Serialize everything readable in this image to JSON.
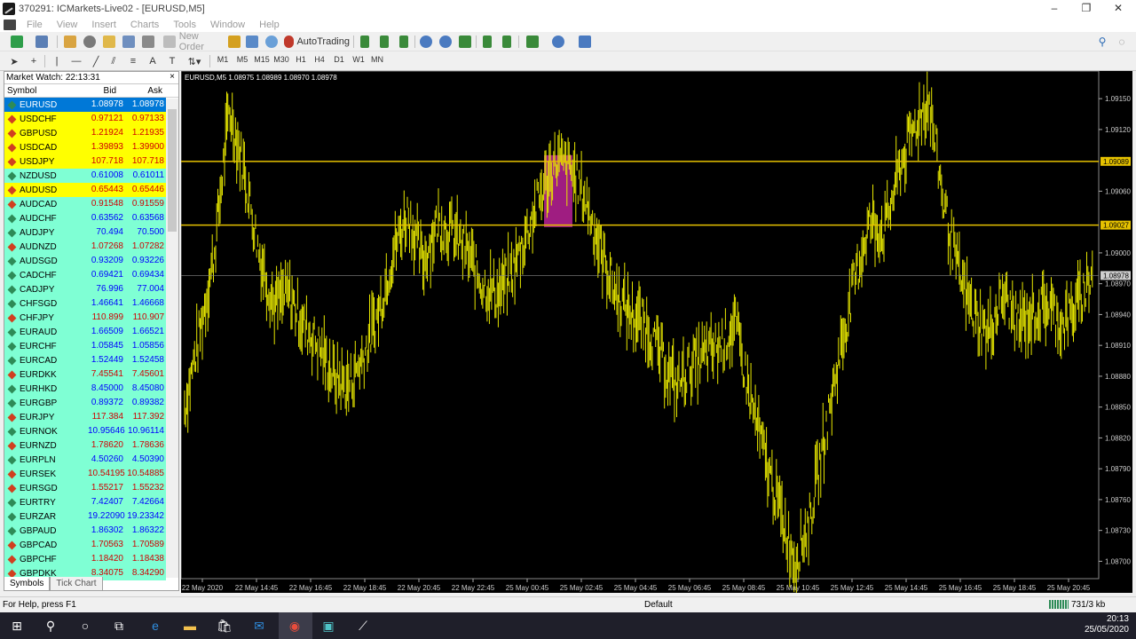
{
  "window": {
    "title": "370291: ICMarkets-Live02 - [EURUSD,M5]",
    "minimize": "–",
    "restore": "❐",
    "close": "✕"
  },
  "menu": [
    "File",
    "View",
    "Insert",
    "Charts",
    "Tools",
    "Window",
    "Help"
  ],
  "toolbar": {
    "new_order": "New Order",
    "autotrading": "AutoTrading",
    "timeframes": [
      "M1",
      "M5",
      "M15",
      "M30",
      "H1",
      "H4",
      "D1",
      "W1",
      "MN"
    ]
  },
  "market_watch": {
    "title": "Market Watch: 22:13:31",
    "close": "×",
    "col_symbol": "Symbol",
    "col_bid": "Bid",
    "col_ask": "Ask",
    "rows": [
      {
        "symbol": "EURUSD",
        "bid": "1.08978",
        "ask": "1.08978",
        "color": "#0078d7",
        "dir": "up"
      },
      {
        "symbol": "USDCHF",
        "bid": "0.97121",
        "ask": "0.97133",
        "color": "#ffff00",
        "dir": "down"
      },
      {
        "symbol": "GBPUSD",
        "bid": "1.21924",
        "ask": "1.21935",
        "color": "#ffff00",
        "dir": "down"
      },
      {
        "symbol": "USDCAD",
        "bid": "1.39893",
        "ask": "1.39900",
        "color": "#ffff00",
        "dir": "down"
      },
      {
        "symbol": "USDJPY",
        "bid": "107.718",
        "ask": "107.718",
        "color": "#ffff00",
        "dir": "down"
      },
      {
        "symbol": "NZDUSD",
        "bid": "0.61008",
        "ask": "0.61011",
        "color": "#7fffd4",
        "dir": "up"
      },
      {
        "symbol": "AUDUSD",
        "bid": "0.65443",
        "ask": "0.65446",
        "color": "#ffff00",
        "dir": "down"
      },
      {
        "symbol": "AUDCAD",
        "bid": "0.91548",
        "ask": "0.91559",
        "color": "#7fffd4",
        "dir": "down"
      },
      {
        "symbol": "AUDCHF",
        "bid": "0.63562",
        "ask": "0.63568",
        "color": "#7fffd4",
        "dir": "up"
      },
      {
        "symbol": "AUDJPY",
        "bid": "70.494",
        "ask": "70.500",
        "color": "#7fffd4",
        "dir": "up"
      },
      {
        "symbol": "AUDNZD",
        "bid": "1.07268",
        "ask": "1.07282",
        "color": "#7fffd4",
        "dir": "down"
      },
      {
        "symbol": "AUDSGD",
        "bid": "0.93209",
        "ask": "0.93226",
        "color": "#7fffd4",
        "dir": "up"
      },
      {
        "symbol": "CADCHF",
        "bid": "0.69421",
        "ask": "0.69434",
        "color": "#7fffd4",
        "dir": "up"
      },
      {
        "symbol": "CADJPY",
        "bid": "76.996",
        "ask": "77.004",
        "color": "#7fffd4",
        "dir": "up"
      },
      {
        "symbol": "CHFSGD",
        "bid": "1.46641",
        "ask": "1.46668",
        "color": "#7fffd4",
        "dir": "up"
      },
      {
        "symbol": "CHFJPY",
        "bid": "110.899",
        "ask": "110.907",
        "color": "#7fffd4",
        "dir": "down"
      },
      {
        "symbol": "EURAUD",
        "bid": "1.66509",
        "ask": "1.66521",
        "color": "#7fffd4",
        "dir": "up"
      },
      {
        "symbol": "EURCHF",
        "bid": "1.05845",
        "ask": "1.05856",
        "color": "#7fffd4",
        "dir": "up"
      },
      {
        "symbol": "EURCAD",
        "bid": "1.52449",
        "ask": "1.52458",
        "color": "#7fffd4",
        "dir": "up"
      },
      {
        "symbol": "EURDKK",
        "bid": "7.45541",
        "ask": "7.45601",
        "color": "#7fffd4",
        "dir": "down"
      },
      {
        "symbol": "EURHKD",
        "bid": "8.45000",
        "ask": "8.45080",
        "color": "#7fffd4",
        "dir": "up"
      },
      {
        "symbol": "EURGBP",
        "bid": "0.89372",
        "ask": "0.89382",
        "color": "#7fffd4",
        "dir": "up"
      },
      {
        "symbol": "EURJPY",
        "bid": "117.384",
        "ask": "117.392",
        "color": "#7fffd4",
        "dir": "down"
      },
      {
        "symbol": "EURNOK",
        "bid": "10.95646",
        "ask": "10.96114",
        "color": "#7fffd4",
        "dir": "up"
      },
      {
        "symbol": "EURNZD",
        "bid": "1.78620",
        "ask": "1.78636",
        "color": "#7fffd4",
        "dir": "down"
      },
      {
        "symbol": "EURPLN",
        "bid": "4.50260",
        "ask": "4.50390",
        "color": "#7fffd4",
        "dir": "up"
      },
      {
        "symbol": "EURSEK",
        "bid": "10.54195",
        "ask": "10.54885",
        "color": "#7fffd4",
        "dir": "down"
      },
      {
        "symbol": "EURSGD",
        "bid": "1.55217",
        "ask": "1.55232",
        "color": "#7fffd4",
        "dir": "down"
      },
      {
        "symbol": "EURTRY",
        "bid": "7.42407",
        "ask": "7.42664",
        "color": "#7fffd4",
        "dir": "up"
      },
      {
        "symbol": "EURZAR",
        "bid": "19.22090",
        "ask": "19.23342",
        "color": "#7fffd4",
        "dir": "up"
      },
      {
        "symbol": "GBPAUD",
        "bid": "1.86302",
        "ask": "1.86322",
        "color": "#7fffd4",
        "dir": "up"
      },
      {
        "symbol": "GBPCAD",
        "bid": "1.70563",
        "ask": "1.70589",
        "color": "#7fffd4",
        "dir": "down"
      },
      {
        "symbol": "GBPCHF",
        "bid": "1.18420",
        "ask": "1.18438",
        "color": "#7fffd4",
        "dir": "down"
      },
      {
        "symbol": "GBPDKK",
        "bid": "8.34075",
        "ask": "8.34290",
        "color": "#7fffd4",
        "dir": "down"
      }
    ],
    "tabs": [
      "Symbols",
      "Tick Chart"
    ]
  },
  "chart": {
    "info": "EURUSD,M5  1.08975 1.08989 1.08970 1.08978",
    "price_labels": [
      "1.09150",
      "1.09120",
      "1.09060",
      "1.09000",
      "1.08970",
      "1.08940",
      "1.08910",
      "1.08880",
      "1.08850",
      "1.08820",
      "1.08790",
      "1.08760",
      "1.08730",
      "1.08700"
    ],
    "marker_labels": [
      "1.09089",
      "1.09027",
      "1.08978"
    ],
    "time_labels": [
      "22 May 2020",
      "22 May 14:45",
      "22 May 16:45",
      "22 May 18:45",
      "22 May 20:45",
      "22 May 22:45",
      "25 May 00:45",
      "25 May 02:45",
      "25 May 04:45",
      "25 May 06:45",
      "25 May 08:45",
      "25 May 10:45",
      "25 May 12:45",
      "25 May 14:45",
      "25 May 16:45",
      "25 May 18:45",
      "25 May 20:45"
    ],
    "price_path": [
      1.0885,
      1.0892,
      1.09,
      1.0914,
      1.0908,
      1.09,
      1.0895,
      1.0896,
      1.0893,
      1.0891,
      1.0888,
      1.0887,
      1.089,
      1.0894,
      1.09,
      1.0904,
      1.0899,
      1.0903,
      1.0902,
      1.09,
      1.0897,
      1.0896,
      1.0898,
      1.0902,
      1.0906,
      1.0909,
      1.0908,
      1.0905,
      1.09,
      1.0896,
      1.0894,
      1.0893,
      1.089,
      1.0887,
      1.0889,
      1.089,
      1.0891,
      1.0893,
      1.0886,
      1.088,
      1.0875,
      1.087,
      1.0874,
      1.0882,
      1.089,
      1.0897,
      1.0903,
      1.0902,
      1.0908,
      1.0912,
      1.0915,
      1.0905,
      1.0898,
      1.0894,
      1.0892,
      1.0896,
      1.0893,
      1.0894,
      1.0895,
      1.0893,
      1.0895,
      1.0898
    ],
    "line_color": "#e6e600"
  },
  "status": {
    "help": "For Help, press F1",
    "profile": "Default",
    "traffic": "731/3 kb"
  },
  "clock": {
    "time": "20:13",
    "date": "25/05/2020"
  }
}
